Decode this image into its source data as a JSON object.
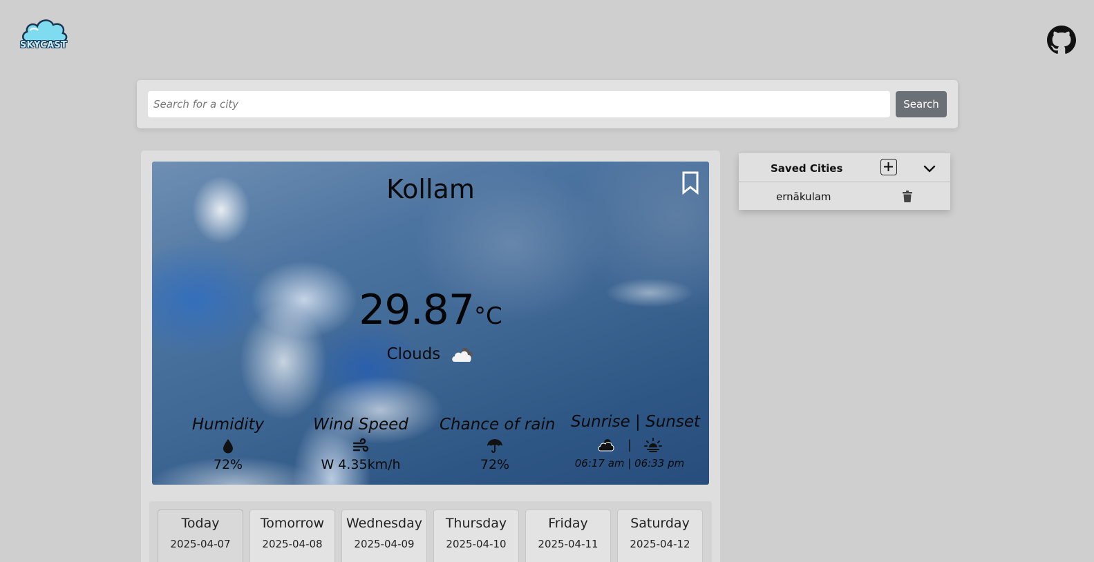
{
  "app": {
    "logo_text": "SKYCAST"
  },
  "search": {
    "placeholder": "Search for a city",
    "value": "",
    "button_label": "Search"
  },
  "current": {
    "city": "Kollam",
    "temperature": "29.87",
    "unit": "°C",
    "condition": "Clouds"
  },
  "stats": {
    "humidity": {
      "label": "Humidity",
      "value": "72%"
    },
    "wind": {
      "label": "Wind Speed",
      "value": "W 4.35km/h"
    },
    "rain": {
      "label": "Chance of rain",
      "value": "72%"
    },
    "sun": {
      "label": "Sunrise | Sunset",
      "separator": "|",
      "times": "06:17 am | 06:33 pm"
    }
  },
  "forecast": {
    "days": [
      {
        "name": "Today",
        "date": "2025-04-07"
      },
      {
        "name": "Tomorrow",
        "date": "2025-04-08"
      },
      {
        "name": "Wednesday",
        "date": "2025-04-09"
      },
      {
        "name": "Thursday",
        "date": "2025-04-10"
      },
      {
        "name": "Friday",
        "date": "2025-04-11"
      },
      {
        "name": "Saturday",
        "date": "2025-04-12"
      }
    ]
  },
  "saved_cities": {
    "title": "Saved Cities",
    "items": [
      {
        "name": "ernākulam"
      }
    ]
  },
  "colors": {
    "page_bg": "#cfcfcf",
    "search_button": "#6b7077",
    "card_bg": "#dedede"
  }
}
